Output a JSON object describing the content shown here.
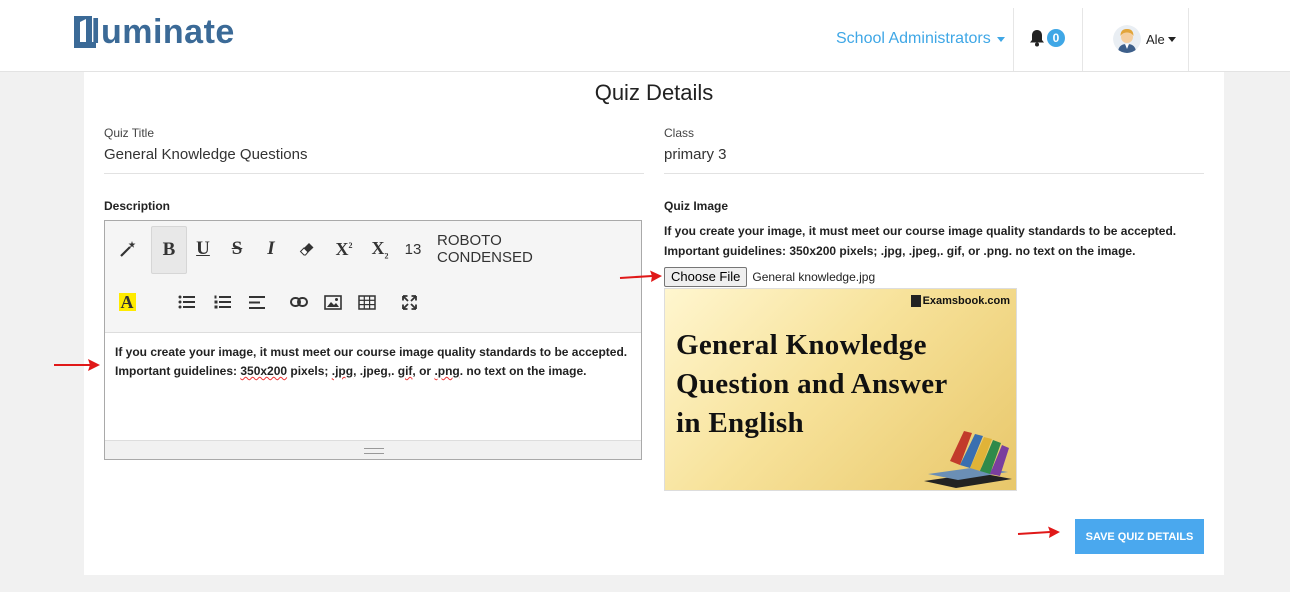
{
  "header": {
    "logo_text": "luminate",
    "role_menu_label": "School Administrators",
    "notification_count": "0",
    "user_name": "Ale"
  },
  "page": {
    "title": "Quiz Details"
  },
  "form": {
    "quiz_title_label": "Quiz Title",
    "quiz_title_value": "General Knowledge Questions",
    "class_label": "Class",
    "class_value": "primary 3",
    "description_label": "Description",
    "quiz_image_label": "Quiz Image",
    "quiz_image_note": "If you create your image, it must meet our course image quality standards to be accepted. Important guidelines: 350x200 pixels; .jpg, .jpeg,. gif, or .png. no text on the image.",
    "choose_file_label": "Choose File",
    "file_name": "General knowledge.jpg",
    "save_button_label": "SAVE QUIZ DETAILS"
  },
  "editor": {
    "font_size": "13",
    "font_name": "ROBOTO CONDENSED",
    "content_part1": "If you create your image, it must meet our course image quality standards to be accepted. Important guidelines: ",
    "content_size": "350x200",
    "content_part2": " pixels; ",
    "content_jpg": ".jpg",
    "content_part3": ", .jpeg,. ",
    "content_gif": "gif",
    "content_part4": ", or ",
    "content_png": ".png",
    "content_part5": ". no text on the image.",
    "toolbar_icons": [
      "magic-wand-icon",
      "bold-icon",
      "underline-icon",
      "strikethrough-icon",
      "italic-icon",
      "eraser-icon",
      "superscript-icon",
      "subscript-icon",
      "text-color-icon",
      "unordered-list-icon",
      "ordered-list-icon",
      "align-icon",
      "link-icon",
      "image-icon",
      "table-icon",
      "fullscreen-icon"
    ]
  },
  "preview_image": {
    "brand": "Examsbook.com",
    "line1": "General Knowledge",
    "line2": "Question and Answer",
    "line3": "in English"
  },
  "colors": {
    "accent": "#3fa7e6",
    "logo": "#3b6a97",
    "save_button": "#4aa8ee",
    "arrow": "#e01818"
  }
}
